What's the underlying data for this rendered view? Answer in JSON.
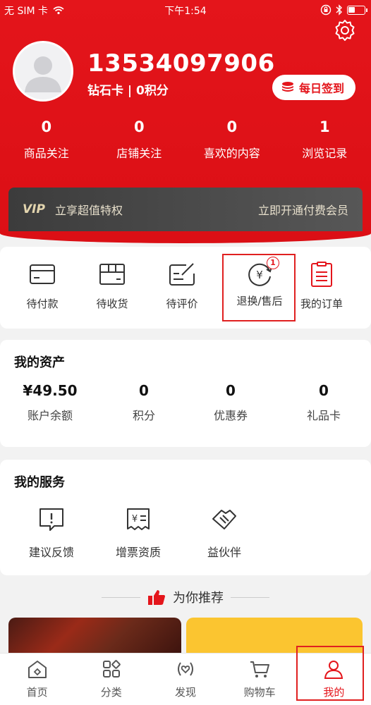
{
  "status_bar": {
    "carrier": "无 SIM 卡",
    "time": "下午1:54"
  },
  "profile": {
    "phone": "13534097906",
    "member_info": "钻石卡 | 0积分",
    "signin_label": "每日签到"
  },
  "stats": [
    {
      "value": "0",
      "label": "商品关注"
    },
    {
      "value": "0",
      "label": "店铺关注"
    },
    {
      "value": "0",
      "label": "喜欢的内容"
    },
    {
      "value": "1",
      "label": "浏览记录"
    }
  ],
  "vip": {
    "logo": "VIP",
    "left": "立享超值特权",
    "right": "立即开通付费会员"
  },
  "orders": {
    "items": [
      {
        "label": "待付款",
        "icon": "wallet-icon"
      },
      {
        "label": "待收货",
        "icon": "package-icon"
      },
      {
        "label": "待评价",
        "icon": "review-icon"
      },
      {
        "label": "退换/售后",
        "icon": "refund-icon",
        "badge": "1"
      },
      {
        "label": "我的订单",
        "icon": "clipboard-icon"
      }
    ]
  },
  "assets": {
    "title": "我的资产",
    "items": [
      {
        "value": "¥49.50",
        "label": "账户余额"
      },
      {
        "value": "0",
        "label": "积分"
      },
      {
        "value": "0",
        "label": "优惠券"
      },
      {
        "value": "0",
        "label": "礼品卡"
      }
    ]
  },
  "services": {
    "title": "我的服务",
    "items": [
      {
        "label": "建议反馈",
        "icon": "feedback-icon"
      },
      {
        "label": "增票资质",
        "icon": "invoice-icon"
      },
      {
        "label": "益伙伴",
        "icon": "handshake-icon"
      }
    ]
  },
  "recommend": {
    "title": "为你推荐"
  },
  "tabbar": [
    {
      "label": "首页",
      "icon": "home-icon"
    },
    {
      "label": "分类",
      "icon": "category-icon"
    },
    {
      "label": "发现",
      "icon": "discover-icon"
    },
    {
      "label": "购物车",
      "icon": "cart-icon"
    },
    {
      "label": "我的",
      "icon": "user-icon",
      "active": true
    }
  ],
  "colors": {
    "brand": "#e4151b",
    "vip_bg": "#3c3c3c",
    "highlight": "#e02020"
  }
}
